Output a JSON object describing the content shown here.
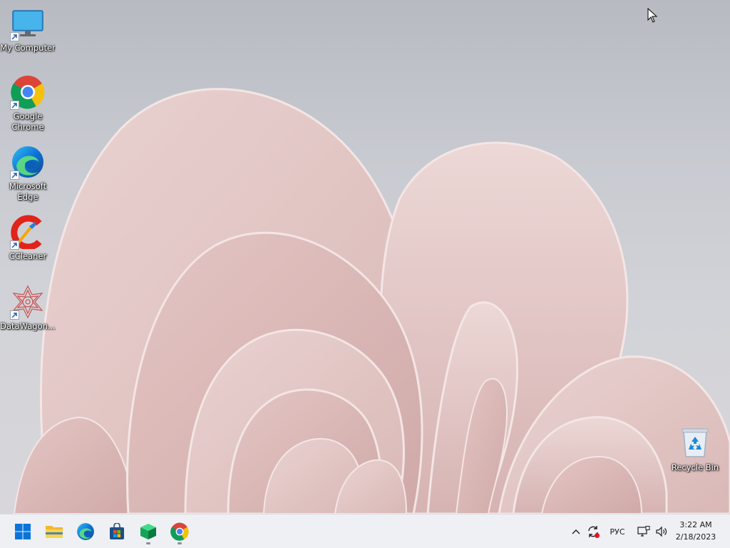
{
  "desktop": {
    "icons": [
      {
        "label": "My Computer",
        "icon": "monitor-icon"
      },
      {
        "label": "Google Chrome",
        "icon": "chrome-icon"
      },
      {
        "label": "Microsoft Edge",
        "icon": "edge-icon"
      },
      {
        "label": "CCleaner",
        "icon": "ccleaner-icon"
      },
      {
        "label": "DataWagon...",
        "icon": "datawagon-icon"
      }
    ],
    "recycle_bin": {
      "label": "Recycle Bin",
      "icon": "recycle-bin-icon"
    }
  },
  "taskbar": {
    "pinned": [
      {
        "name": "Start",
        "icon": "windows-start-icon"
      },
      {
        "name": "File Explorer",
        "icon": "folder-icon"
      },
      {
        "name": "Microsoft Edge",
        "icon": "edge-icon"
      },
      {
        "name": "Microsoft Store",
        "icon": "store-icon"
      },
      {
        "name": "App",
        "icon": "green-cube-icon",
        "running": true
      },
      {
        "name": "Google Chrome",
        "icon": "chrome-icon",
        "running": true
      }
    ],
    "tray": {
      "language": "РУС",
      "icons": [
        "chevron-up-icon",
        "sync-icon",
        "network-icon",
        "volume-icon"
      ]
    },
    "clock": {
      "time": "3:22 AM",
      "date": "2/18/2023"
    }
  },
  "colors": {
    "wallpaper_petal": "#e6cdcb",
    "taskbar_bg": "#eef0f4",
    "windows_blue": "#0a74da",
    "sync_badge": "#e81123"
  }
}
